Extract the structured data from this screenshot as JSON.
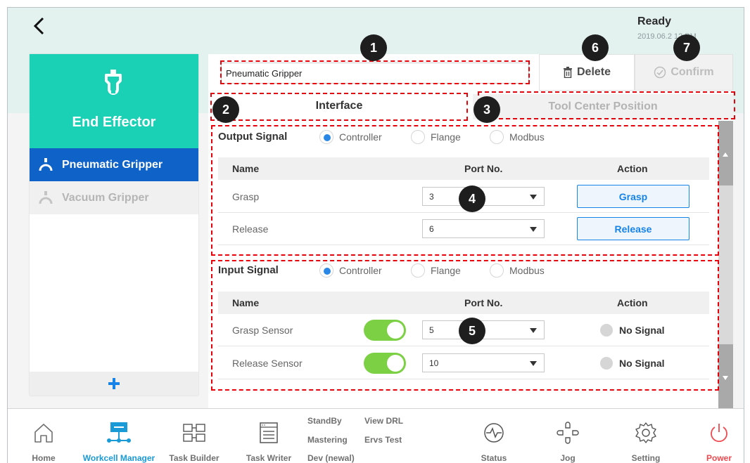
{
  "status": {
    "state": "Ready",
    "timestamp": "2019.06.2 12 PM"
  },
  "left_panel": {
    "title": "End Effector",
    "tools": [
      {
        "label": "Pneumatic Gripper",
        "selected": true
      },
      {
        "label": "Vacuum Gripper",
        "selected": false
      }
    ],
    "add_label": "+"
  },
  "main": {
    "tool_name_value": "Pneumatic Gripper",
    "delete_label": "Delete",
    "confirm_label": "Confirm",
    "tabs": [
      {
        "label": "Interface",
        "active": true
      },
      {
        "label": "Tool Center Position",
        "active": false
      }
    ],
    "output_signal": {
      "label": "Output Signal",
      "options": [
        "Controller",
        "Flange",
        "Modbus"
      ],
      "selected": "Controller",
      "columns": [
        "Name",
        "Port No.",
        "Action"
      ],
      "rows": [
        {
          "name": "Grasp",
          "port": "3",
          "action": "Grasp"
        },
        {
          "name": "Release",
          "port": "6",
          "action": "Release"
        }
      ]
    },
    "input_signal": {
      "label": "Input Signal",
      "options": [
        "Controller",
        "Flange",
        "Modbus"
      ],
      "selected": "Controller",
      "columns": [
        "Name",
        "Port No.",
        "Action"
      ],
      "rows": [
        {
          "name": "Grasp Sensor",
          "enabled": true,
          "port": "5",
          "action": "No Signal"
        },
        {
          "name": "Release Sensor",
          "enabled": true,
          "port": "10",
          "action": "No Signal"
        }
      ]
    }
  },
  "annotations": [
    "1",
    "2",
    "3",
    "4",
    "5",
    "6",
    "7"
  ],
  "bottom_nav": {
    "home": "Home",
    "workcell": "Workcell Manager",
    "task_builder": "Task Builder",
    "task_writer": "Task Writer",
    "standby": "StandBy",
    "mastering": "Mastering",
    "dev": "Dev (newal)",
    "view_drl": "View DRL",
    "ervs_test": "Ervs Test",
    "status": "Status",
    "jog": "Jog",
    "setting": "Setting",
    "power": "Power"
  },
  "colors": {
    "accent": "#1ad1b5",
    "selected_tool": "#0f63c8",
    "toggle_on": "#7bd143",
    "annotation_dash": "#e8000b",
    "power": "#f0484e",
    "workcell_active": "#1a9ad6"
  }
}
